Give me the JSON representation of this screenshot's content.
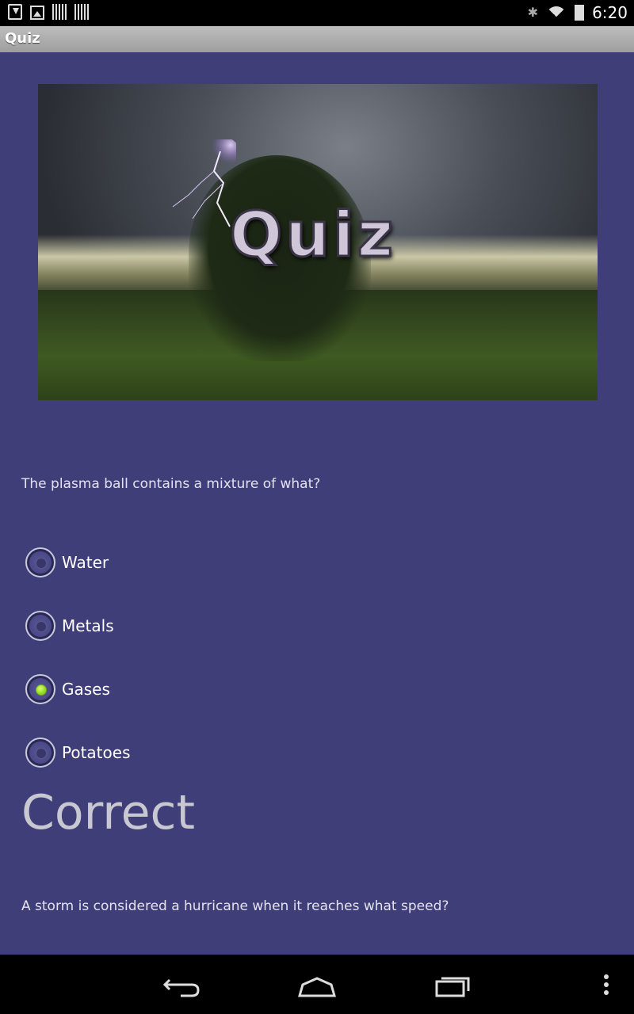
{
  "status_bar": {
    "time": "6:20",
    "icons": [
      "download-icon",
      "image-icon",
      "barcode-icon",
      "barcode-icon",
      "bluetooth-icon",
      "wifi-icon",
      "battery-charging-icon"
    ]
  },
  "action_bar": {
    "title": "Quiz"
  },
  "banner": {
    "title": "Quiz"
  },
  "question1": {
    "text": "The plasma ball contains a mixture of what?",
    "options": [
      "Water",
      "Metals",
      "Gases",
      "Potatoes"
    ],
    "selected": "Gases"
  },
  "result": "Correct",
  "question2": {
    "text": "A storm is considered a hurricane when it reaches what speed?"
  },
  "nav_bar": {
    "buttons": [
      "back-icon",
      "home-icon",
      "recents-icon",
      "menu-icon"
    ]
  },
  "colors": {
    "content_bg": "#403e78",
    "action_bar": "#a9a9a9",
    "selected_radio": "#8bd21e"
  }
}
